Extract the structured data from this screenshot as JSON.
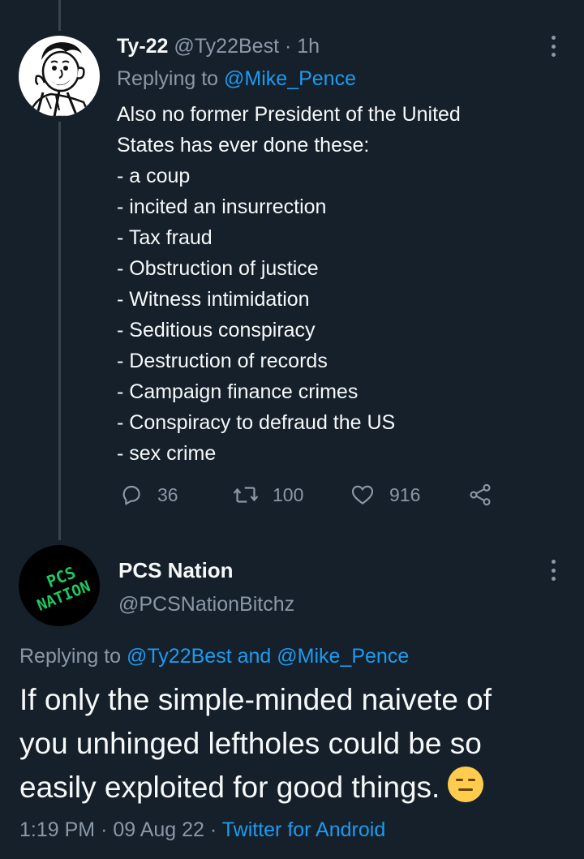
{
  "tweet1": {
    "display_name": "Ty-22",
    "handle": "@Ty22Best",
    "separator": "·",
    "time": "1h",
    "replying_prefix": "Replying to",
    "replying_to": "@Mike_Pence",
    "lines": [
      "Also no former President of the United",
      "States has ever done these:",
      "- a coup",
      "- incited an insurrection",
      "- Tax fraud",
      "- Obstruction of justice",
      "- Witness intimidation",
      "- Seditious conspiracy",
      "- Destruction of records",
      "- Campaign finance crimes",
      "- Conspiracy to defraud the US",
      "- sex crime"
    ],
    "actions": {
      "replies": "36",
      "retweets": "100",
      "likes": "916"
    }
  },
  "tweet2": {
    "display_name": "PCS Nation",
    "handle": "@PCSNationBitchz",
    "avatar_text_line1": "PCS",
    "avatar_text_line2": "NATION",
    "replying_prefix": "Replying to",
    "replying_to_1": "@Ty22Best",
    "replying_and": "and",
    "replying_to_2": "@Mike_Pence",
    "body_lines": [
      "If only the simple-minded naivete of",
      "you unhinged leftholes could be so",
      "easily exploited for good things."
    ],
    "emoji": "expressionless-face",
    "time": "1:19 PM",
    "separator": "·",
    "date": "09 Aug 22",
    "separator2": "·",
    "source": "Twitter for Android"
  },
  "colors": {
    "background": "#15202b",
    "text": "#f7f9f9",
    "muted": "#8b98a5",
    "link": "#1d9bf0",
    "thread_line": "#38444d",
    "avatar_logo_green": "#22c55e",
    "emoji_yellow": "#ffcc4d"
  }
}
